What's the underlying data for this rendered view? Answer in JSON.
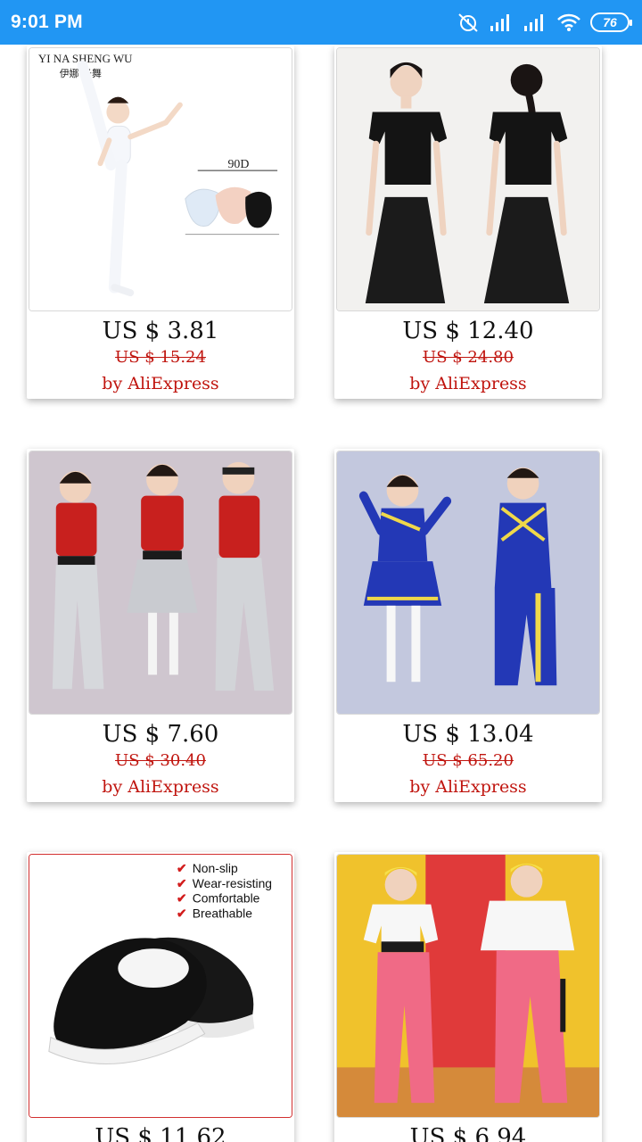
{
  "status_bar": {
    "time": "9:01 PM",
    "battery": "76",
    "bg_color": "#2196F3"
  },
  "products": [
    {
      "price": "US $ 3.81",
      "old_price": "US $ 15.24",
      "seller": "by AliExpress",
      "image": "ballet-tights-girl-image",
      "brand_text": "YI NA SHENG WU",
      "brand_cn": "伊娜 圣舞",
      "size_text": "90D"
    },
    {
      "price": "US $ 12.40",
      "old_price": "US $ 24.80",
      "seller": "by AliExpress",
      "image": "black-dance-dress-image"
    },
    {
      "price": "US $ 7.60",
      "old_price": "US $ 30.40",
      "seller": "by AliExpress",
      "image": "sequin-hiphop-kids-image"
    },
    {
      "price": "US $ 13.04",
      "old_price": "US $ 65.20",
      "seller": "by AliExpress",
      "image": "cheerleader-uniform-image"
    },
    {
      "price": "US $ 11.62",
      "old_price": "",
      "seller": "",
      "image": "black-cloth-shoes-image",
      "features": [
        "Non-slip",
        "Wear-resisting",
        "Comfortable",
        "Breathable"
      ]
    },
    {
      "price": "US $ 6.94",
      "old_price": "",
      "seller": "",
      "image": "pink-jogger-kids-image"
    }
  ],
  "colors": {
    "price_text": "#111111",
    "old_price_text": "#c0150f",
    "seller_text": "#c0150f"
  }
}
